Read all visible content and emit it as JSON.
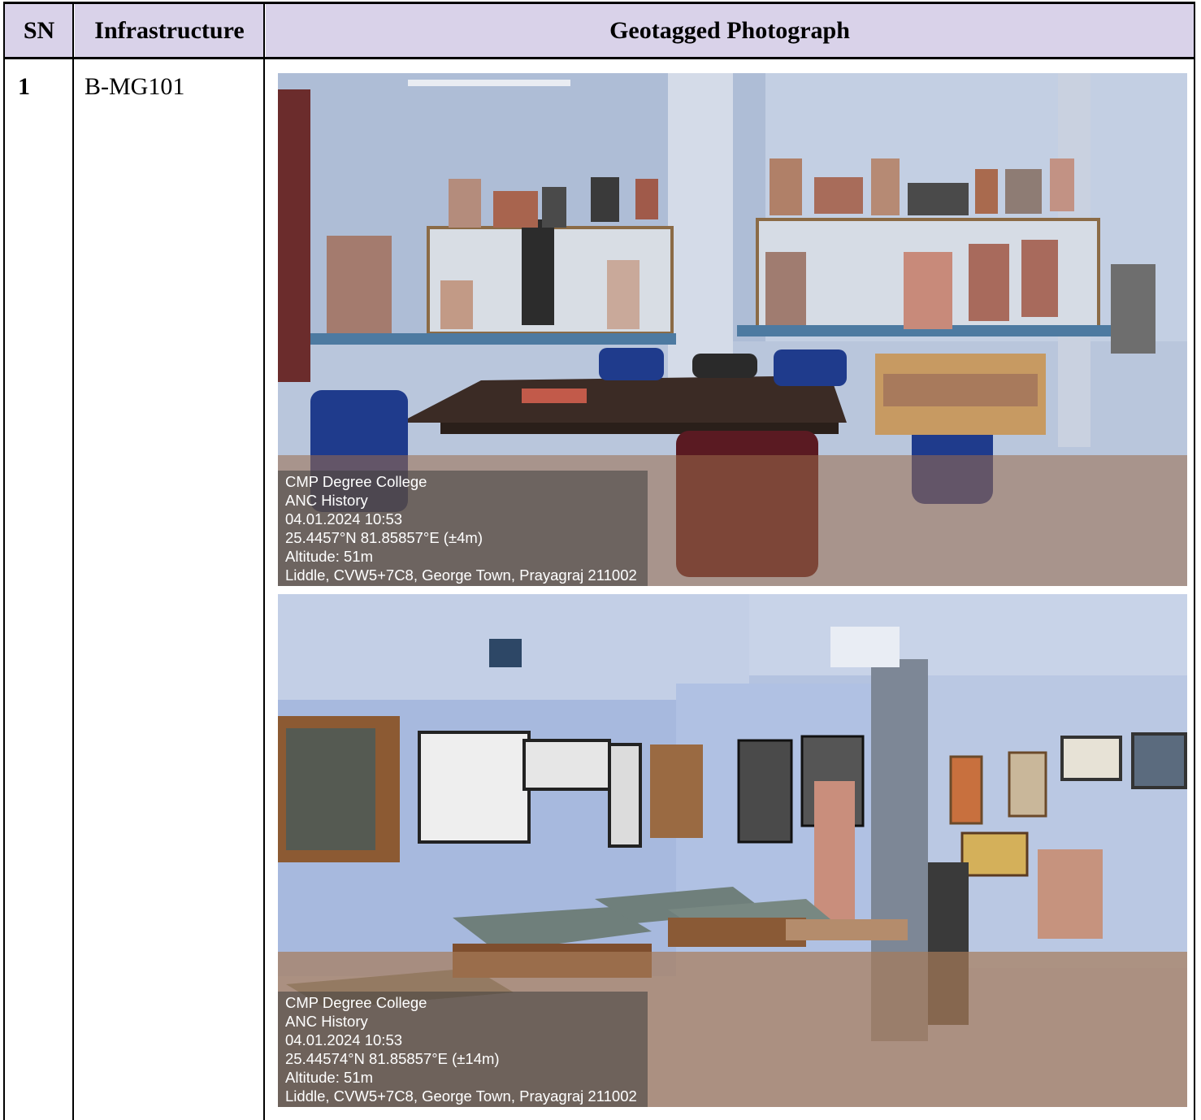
{
  "header": {
    "sn": "SN",
    "infrastructure": "Infrastructure",
    "photo": "Geotagged Photograph"
  },
  "row": {
    "sn": "1",
    "infrastructure": "B-MG101"
  },
  "photos": [
    {
      "lines": [
        "CMP Degree College",
        "ANC History",
        "04.01.2024 10:53",
        "25.4457°N 81.85857°E (±4m)",
        "Altitude: 51m",
        "Liddle, CVW5+7C8, George Town, Prayagraj 211002"
      ]
    },
    {
      "lines": [
        "CMP Degree College",
        "ANC History",
        "04.01.2024 10:53",
        "25.44574°N 81.85857°E (±14m)",
        "Altitude: 51m",
        "Liddle, CVW5+7C8, George Town, Prayagraj 211002"
      ]
    }
  ]
}
